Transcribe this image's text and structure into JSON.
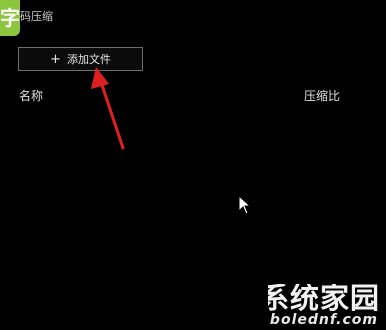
{
  "app": {
    "icon_glyph": "字",
    "title": "码压缩"
  },
  "toolbar": {
    "add_file_label": "添加文件"
  },
  "file_list": {
    "columns": [
      "名称",
      "压缩比"
    ]
  },
  "watermark": {
    "title": "系统家园",
    "url": "www.bolednf.com"
  },
  "colors": {
    "background": "#000000",
    "app_icon": "#8cc63f",
    "arrow": "#e02020",
    "button_border": "#6e6e6e"
  }
}
